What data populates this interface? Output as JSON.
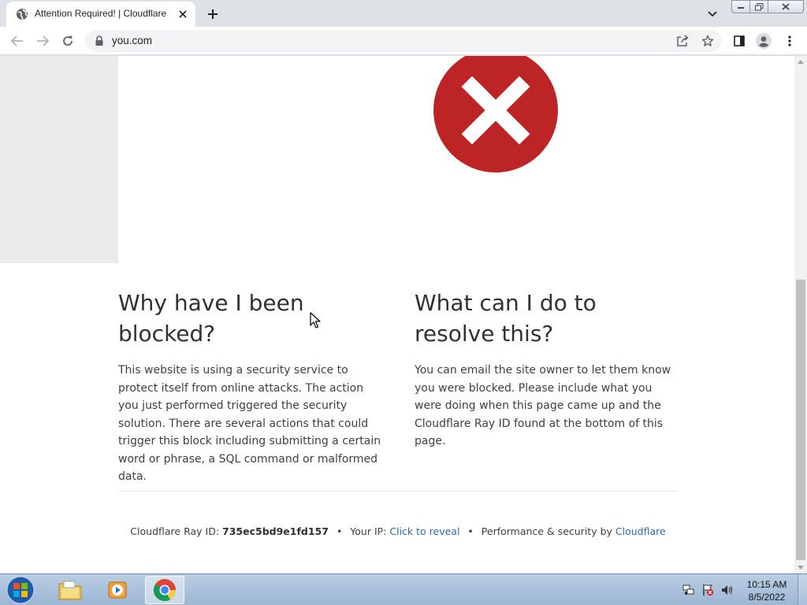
{
  "browser": {
    "tab": {
      "title": "Attention Required! | Cloudflare",
      "favicon": "globe-icon"
    },
    "omnibox": {
      "url": "you.com"
    },
    "accent": "#1a73e8"
  },
  "page": {
    "error_color": "#bd2426",
    "left_heading": "Why have I been blocked?",
    "left_body": "This website is using a security service to protect itself from online attacks. The action you just performed triggered the security solution. There are several actions that could trigger this block including submitting a certain word or phrase, a SQL command or malformed data.",
    "right_heading": "What can I do to resolve this?",
    "right_body": "You can email the site owner to let them know you were blocked. Please include what you were doing when this page came up and the Cloudflare Ray ID found at the bottom of this page.",
    "footer": {
      "ray_label": "Cloudflare Ray ID:",
      "ray_id": "735ec5bd9e1fd157",
      "ip_label": "Your IP:",
      "ip_link": "Click to reveal",
      "perf_label": "Performance & security by",
      "perf_link": "Cloudflare",
      "separator": "•"
    }
  },
  "taskbar": {
    "time": "10:15 AM",
    "date": "8/5/2022"
  }
}
